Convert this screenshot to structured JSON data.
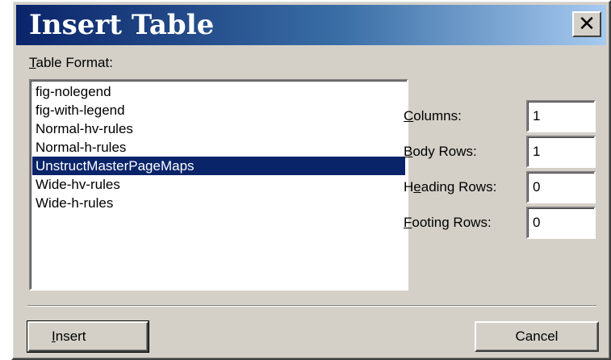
{
  "dialog": {
    "title": "Insert Table",
    "close_label": "✕"
  },
  "table_format": {
    "label_mnemonic": "T",
    "label_rest": "able Format:",
    "items": [
      "fig-nolegend",
      "fig-with-legend",
      "Normal-hv-rules",
      "Normal-h-rules",
      "UnstructMasterPageMaps",
      "Wide-hv-rules",
      "Wide-h-rules"
    ],
    "selected_index": 4
  },
  "fields": {
    "columns": {
      "mnemonic": "C",
      "rest": "olumns:",
      "value": "1"
    },
    "body_rows": {
      "mnemonic": "B",
      "rest": "ody Rows:",
      "value": "1"
    },
    "heading_rows": {
      "pre": "H",
      "mnemonic": "e",
      "rest": "ading Rows:",
      "value": "0"
    },
    "footing_rows": {
      "mnemonic": "F",
      "rest": "ooting Rows:",
      "value": "0"
    }
  },
  "buttons": {
    "insert": {
      "mnemonic": "I",
      "rest": "nsert"
    },
    "cancel": "Cancel"
  },
  "colors": {
    "title_gradient_start": "#0a246a",
    "title_gradient_end": "#a6caf0",
    "selection": "#0a246a",
    "face": "#d4d0c8"
  }
}
